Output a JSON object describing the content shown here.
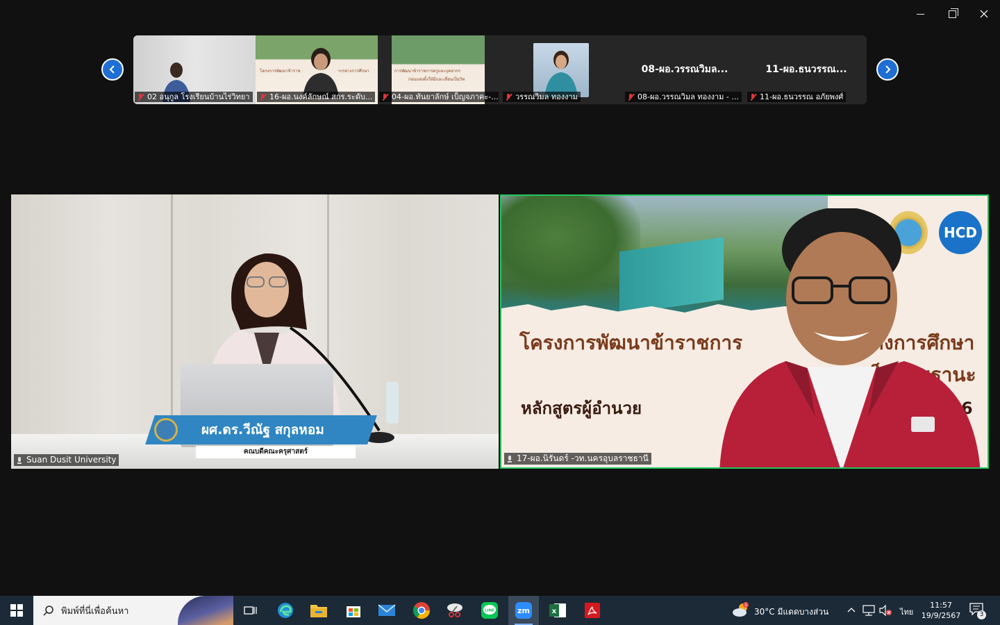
{
  "gallery": {
    "tiles": [
      {
        "name": "02 อนุกูล โรงเรียนบ้านไร่วิทยา",
        "muted": true
      },
      {
        "name": "16-ผอ.นงค์ลักษณ์ สกร.ระดับ...",
        "muted": true
      },
      {
        "name": "04-ผอ.ทันยาลักษ์ เบ็ญจภาคะ-...",
        "muted": true
      },
      {
        "name": "วรรณวิมล ทองงาม",
        "muted": true
      },
      {
        "name": "08-ผอ.วรรณวิมล ทองงาม - ...",
        "big_name": "08-ผอ.วรรณวิมล...",
        "muted": true
      },
      {
        "name": "11-ผอ.ธนวรรณ อภัยพงศ์",
        "big_name": "11-ผอ.ธนวรรณ...",
        "muted": true
      }
    ]
  },
  "main": {
    "left": {
      "label": "Suan Dusit University",
      "nameplate_title": "ผศ.ดร.วีณัฐ สกุลหอม",
      "nameplate_sub": "คณบดีคณะครุศาสตร์"
    },
    "right": {
      "label": "17-ผอ.นิรันดร์ -วท.นครอุบลราชธานี",
      "slide_line1a": "โครงการพัฒนาข้าราชการ",
      "slide_line1b": "ลากรทางการศึกษา",
      "slide_line2": "นเป็นวิทยฐานะ",
      "slide_line3a": "หลักสูตรผู้อำนวย",
      "slide_line3b": "นที่ 146",
      "logo_text": "HCD"
    }
  },
  "taskbar": {
    "search_placeholder": "พิมพ์ที่นี่เพื่อค้นหา",
    "weather": "30°C มีแดดบางส่วน",
    "language": "ไทย",
    "time": "11:57",
    "date": "19/9/2567",
    "notification_count": "3"
  },
  "colors": {
    "accent": "#1f6ed4",
    "active_speaker": "#22c55e",
    "muted": "#e0363a"
  }
}
